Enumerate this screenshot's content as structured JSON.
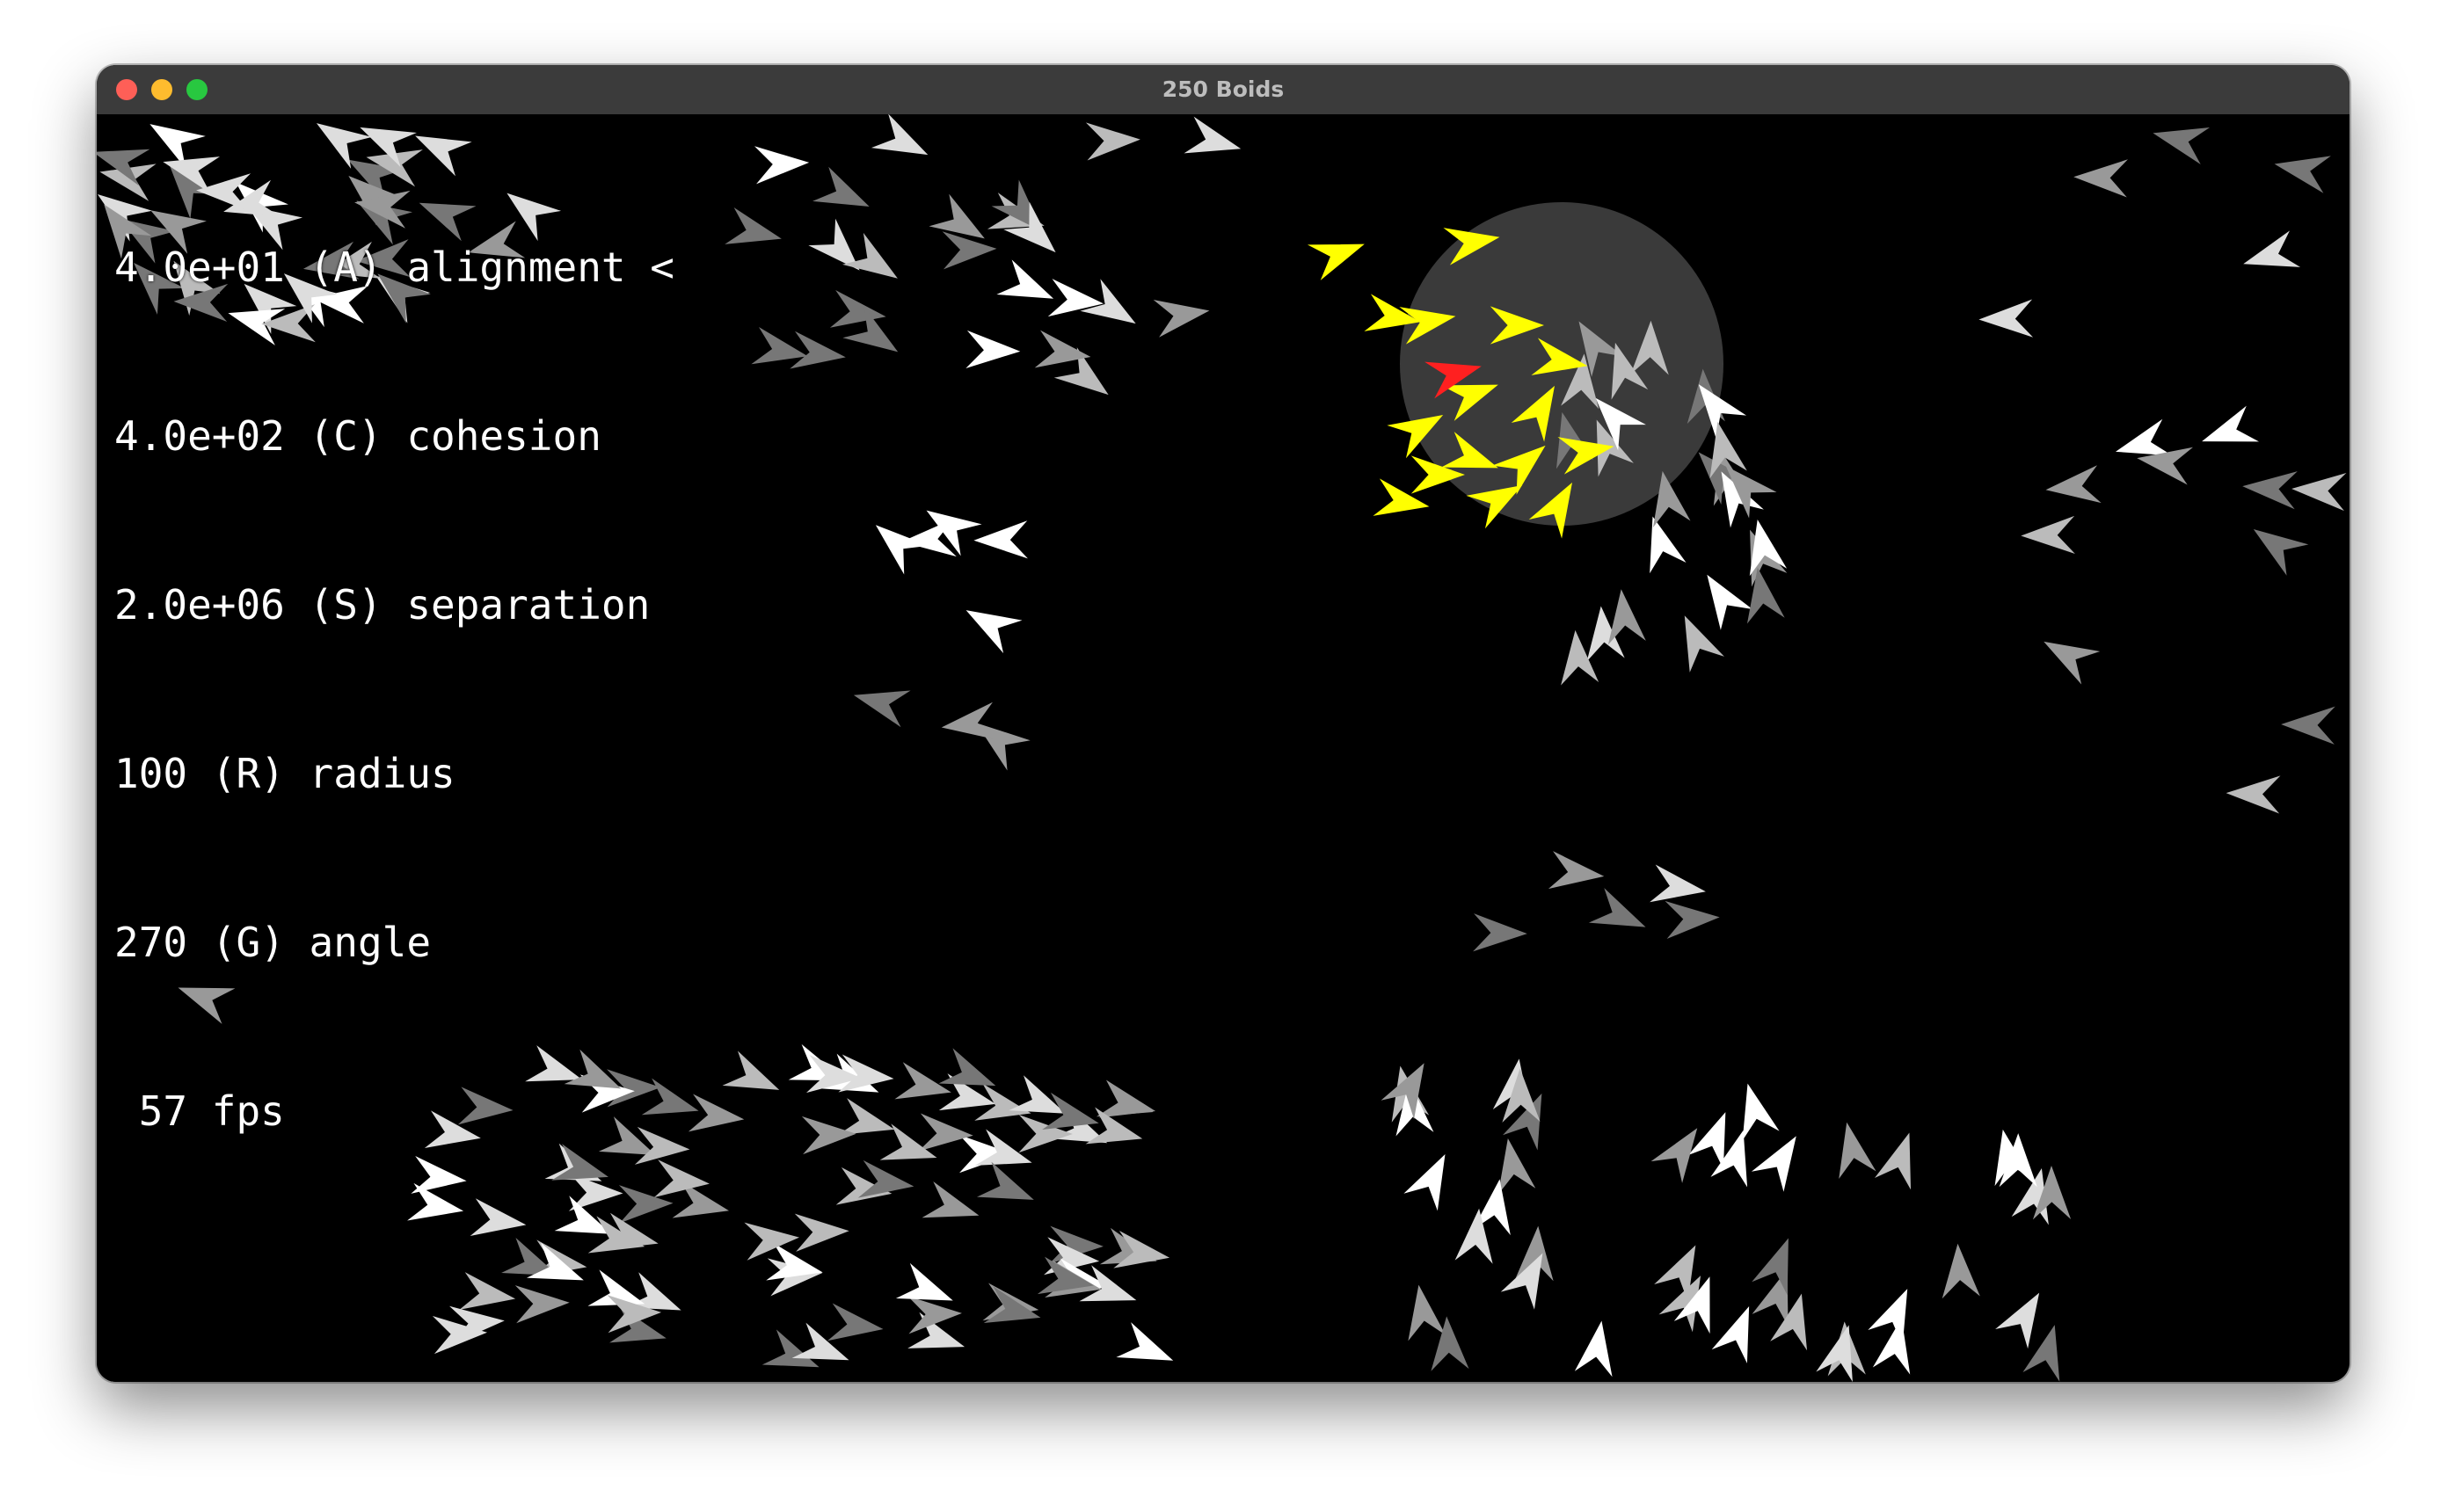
{
  "window": {
    "title": "250 Boids"
  },
  "hud": {
    "lines": [
      "4.0e+01 (A) alignment <",
      "4.0e+02 (C) cohesion",
      "2.0e+06 (S) separation",
      "100 (R) radius",
      "270 (G) angle",
      " 57 fps"
    ]
  },
  "simulation": {
    "boid_count": 250,
    "alignment": "4.0e+01",
    "cohesion": "4.0e+02",
    "separation": "2.0e+06",
    "radius": 100,
    "angle": 270,
    "fps": 57,
    "selected_parameter": "alignment"
  },
  "colors": {
    "background": "#000000",
    "boid_shades": [
      "#ffffff",
      "#dddddd",
      "#bbbbbb",
      "#999999",
      "#777777"
    ],
    "neighbor": "#ffff00",
    "focus": "#ff2020",
    "range_circle": "#3a3a3a"
  }
}
